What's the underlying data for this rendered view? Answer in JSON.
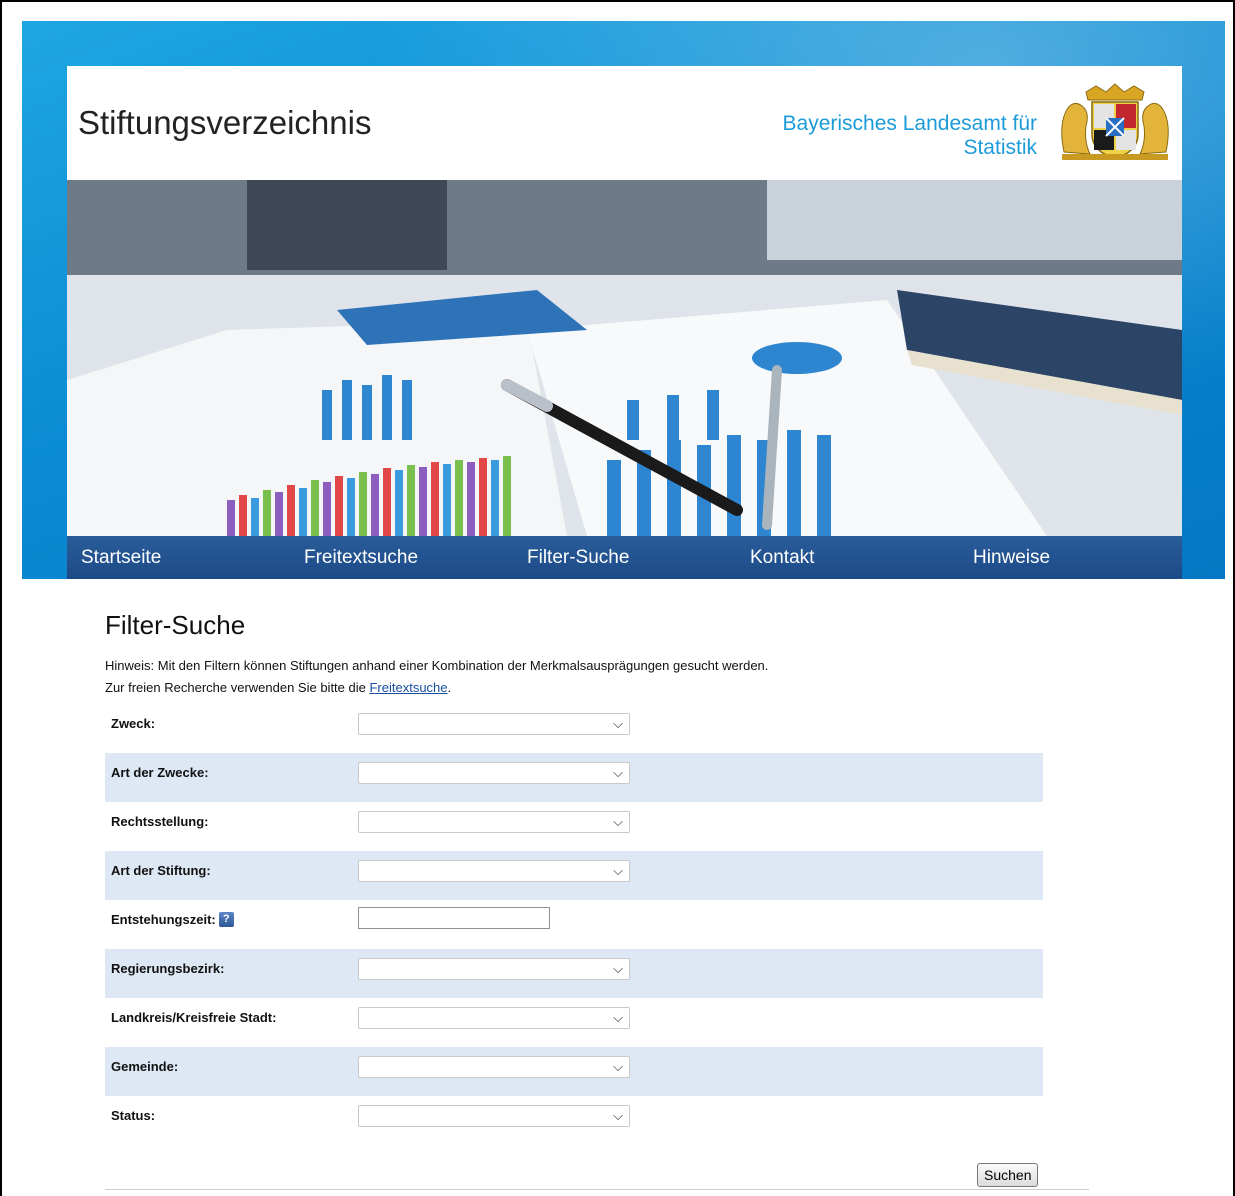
{
  "header": {
    "site_title": "Stiftungsverzeichnis",
    "agency_line1": "Bayerisches Landesamt für",
    "agency_line2": "Statistik"
  },
  "nav": {
    "items": [
      {
        "label": "Startseite"
      },
      {
        "label": "Freitextsuche"
      },
      {
        "label": "Filter-Suche"
      },
      {
        "label": "Kontakt"
      },
      {
        "label": "Hinweise"
      }
    ]
  },
  "page": {
    "heading": "Filter-Suche",
    "hint_line1": "Hinweis: Mit den Filtern können Stiftungen anhand einer Kombination der Merkmalsausprägungen gesucht werden.",
    "hint_line2_prefix": "Zur freien Recherche verwenden Sie bitte die ",
    "hint_link": "Freitextsuche",
    "hint_line2_suffix": "."
  },
  "filters": [
    {
      "label": "Zweck:",
      "value": ""
    },
    {
      "label": "Art der Zwecke:",
      "value": ""
    },
    {
      "label": "Rechtsstellung:",
      "value": ""
    },
    {
      "label": "Art der Stiftung:",
      "value": ""
    },
    {
      "label": "Entstehungszeit:",
      "value": "",
      "help_icon": "?"
    },
    {
      "label": "Regierungsbezirk:",
      "value": ""
    },
    {
      "label": "Landkreis/Kreisfreie Stadt:",
      "value": ""
    },
    {
      "label": "Gemeinde:",
      "value": ""
    },
    {
      "label": "Status:",
      "value": ""
    }
  ],
  "actions": {
    "search_label": "Suchen"
  },
  "colors": {
    "brand_blue": "#0a8bd3",
    "nav_blue": "#1c4a86",
    "agency_text": "#1d9bd8",
    "row_alt": "#dde8f4"
  },
  "icons": {
    "dropdown": "chevron-down-icon",
    "help": "help-icon"
  }
}
